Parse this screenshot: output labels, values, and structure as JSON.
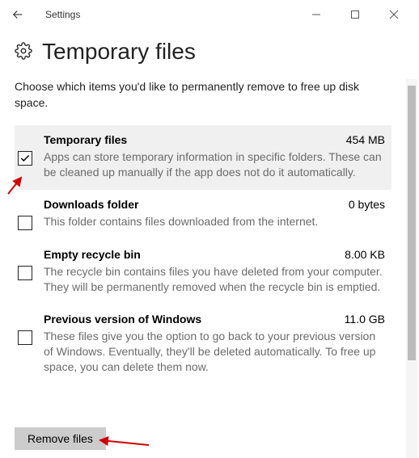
{
  "window": {
    "title": "Settings"
  },
  "page": {
    "heading": "Temporary files",
    "intro": "Choose which items you'd like to permanently remove to free up disk space."
  },
  "items": [
    {
      "title": "Temporary files",
      "size": "454 MB",
      "desc": "Apps can store temporary information in specific folders. These can be cleaned up manually if the app does not do it automatically.",
      "checked": true,
      "hovered": true
    },
    {
      "title": "Downloads folder",
      "size": "0 bytes",
      "desc": "This folder contains files downloaded from the internet.",
      "checked": false,
      "hovered": false
    },
    {
      "title": "Empty recycle bin",
      "size": "8.00 KB",
      "desc": "The recycle bin contains files you have deleted from your computer. They will be permanently removed when the recycle bin is emptied.",
      "checked": false,
      "hovered": false
    },
    {
      "title": "Previous version of Windows",
      "size": "11.0 GB",
      "desc": "These files give you the option to go back to your previous version of Windows. Eventually, they'll be deleted automatically. To free up space, you can delete them now.",
      "checked": false,
      "hovered": false
    }
  ],
  "action": {
    "remove_label": "Remove files"
  }
}
